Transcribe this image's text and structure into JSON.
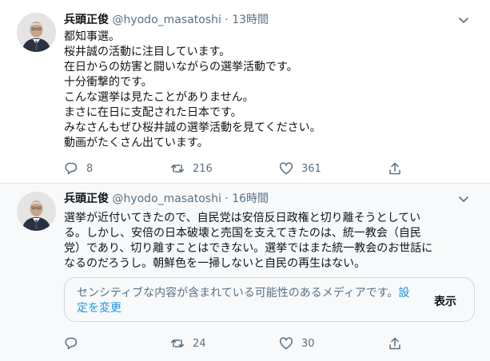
{
  "tweets": [
    {
      "name": "兵頭正俊",
      "handle": "@hyodo_masatoshi",
      "sep": "·",
      "time": "13時間",
      "lines": [
        "都知事選。",
        "桜井誠の活動に注目しています。",
        "在日からの妨害と闘いながらの選挙活動です。",
        "十分衝撃的です。",
        "こんな選挙は見たことがありません。",
        "まさに在日に支配された日本です。",
        "みなさんもぜひ桜井誠の選挙活動を見てください。",
        "動画がたくさん出ています。"
      ],
      "reply_count": "8",
      "retweet_count": "216",
      "like_count": "361"
    },
    {
      "name": "兵頭正俊",
      "handle": "@hyodo_masatoshi",
      "sep": "·",
      "time": "16時間",
      "lines": [
        "選挙が近付いてきたので、自民党は安倍反日政権と切り離そうとしてい",
        "る。しかし、安倍の日本破壊と売国を支えてきたのは、統一教会（自民",
        "党）であり、切り離すことはできない。選挙ではまた統一教会のお世話に",
        "なるのだろうし。朝鮮色を一掃しないと自民の再生はない。"
      ],
      "sensitive_notice": "センシティブな内容が含まれている可能性のあるメディアです。",
      "settings_link": "設定を変更",
      "show_label": "表示",
      "retweet_count": "24",
      "like_count": "30"
    }
  ],
  "icons": {
    "reply": "reply-icon",
    "retweet": "retweet-icon",
    "like": "like-icon",
    "share": "share-icon",
    "caret": "chevron-down-icon"
  },
  "colors": {
    "text": "#0f1419",
    "muted": "#5b7083",
    "link": "#1b95e0",
    "border": "#e1e8ed",
    "highlight_bg": "#f7f9fa"
  }
}
